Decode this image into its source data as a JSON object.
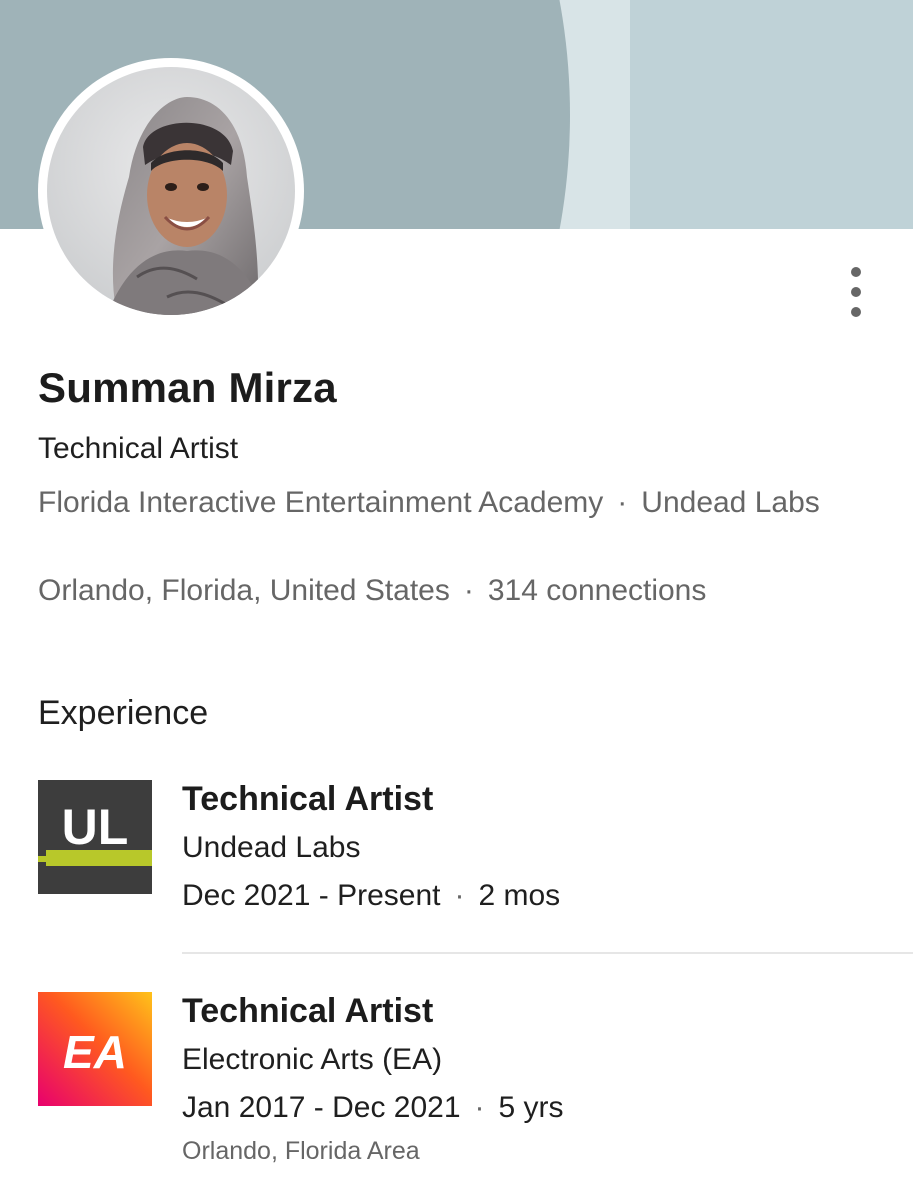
{
  "profile": {
    "name": "Summan Mirza",
    "headline": "Technical Artist",
    "org_primary": "Florida Interactive Entertainment Academy",
    "org_separator": "·",
    "org_secondary": "Undead Labs",
    "location": "Orlando, Florida, United States",
    "location_separator": "·",
    "connections": "314 connections"
  },
  "experience": {
    "section_title": "Experience",
    "items": [
      {
        "title": "Technical Artist",
        "company": "Undead Labs",
        "date_range": "Dec 2021 - Present",
        "separator": "·",
        "duration": "2 mos",
        "logo_text": "UL",
        "logo_icon": "undead-labs-logo"
      },
      {
        "title": "Technical Artist",
        "company": "Electronic Arts (EA)",
        "date_range": "Jan 2017 - Dec 2021",
        "separator": "·",
        "duration": "5 yrs",
        "location": "Orlando, Florida Area",
        "logo_text": "EA",
        "logo_icon": "electronic-arts-logo"
      }
    ]
  },
  "menu": {
    "icon": "more-vertical-icon"
  },
  "colors": {
    "banner_light": "#bfd2d7",
    "banner_dark": "#9fb3b8",
    "banner_strip": "#d8e4e7",
    "secondary_text": "#666666",
    "ul_logo_bg": "#3d3d3d",
    "ul_logo_accent": "#b8c82a",
    "ea_gradient_start": "#e8006e",
    "ea_gradient_end": "#ffc21a"
  }
}
